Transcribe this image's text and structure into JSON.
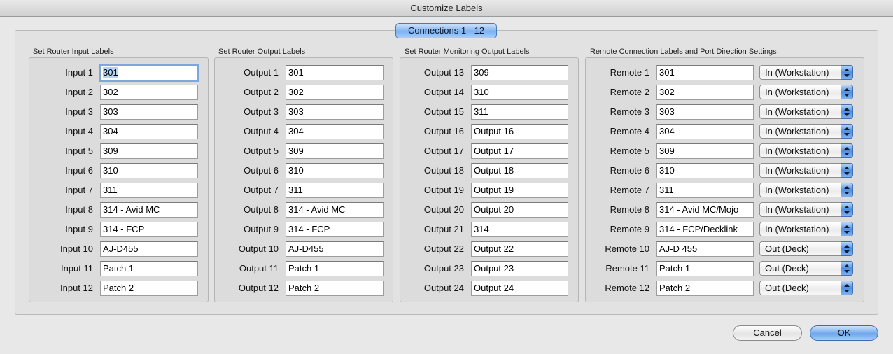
{
  "window": {
    "title": "Customize Labels"
  },
  "tab": {
    "label": "Connections 1 - 12"
  },
  "groups": {
    "inputs": {
      "title": "Set Router Input Labels",
      "labels": [
        "Input 1",
        "Input 2",
        "Input 3",
        "Input 4",
        "Input 5",
        "Input 6",
        "Input 7",
        "Input 8",
        "Input 9",
        "Input 10",
        "Input 11",
        "Input 12"
      ],
      "values": [
        "301",
        "302",
        "303",
        "304",
        "309",
        "310",
        "311",
        "314 - Avid MC",
        "314 - FCP",
        "AJ-D455",
        "Patch 1",
        "Patch 2"
      ]
    },
    "outputs": {
      "title": "Set Router Output Labels",
      "labels": [
        "Output 1",
        "Output 2",
        "Output 3",
        "Output 4",
        "Output 5",
        "Output 6",
        "Output 7",
        "Output 8",
        "Output 9",
        "Output 10",
        "Output 11",
        "Output 12"
      ],
      "values": [
        "301",
        "302",
        "303",
        "304",
        "309",
        "310",
        "311",
        "314 - Avid MC",
        "314 - FCP",
        "AJ-D455",
        "Patch 1",
        "Patch 2"
      ]
    },
    "monitoring": {
      "title": "Set Router Monitoring Output Labels",
      "labels": [
        "Output 13",
        "Output 14",
        "Output 15",
        "Output 16",
        "Output 17",
        "Output 18",
        "Output 19",
        "Output 20",
        "Output 21",
        "Output 22",
        "Output 23",
        "Output 24"
      ],
      "values": [
        "309",
        "310",
        "311",
        "Output 16",
        "Output 17",
        "Output 18",
        "Output 19",
        "Output 20",
        "314",
        "Output 22",
        "Output 23",
        "Output 24"
      ]
    },
    "remote": {
      "title": "Remote Connection Labels and Port Direction Settings",
      "labels": [
        "Remote 1",
        "Remote 2",
        "Remote 3",
        "Remote 4",
        "Remote 5",
        "Remote 6",
        "Remote 7",
        "Remote 8",
        "Remote 9",
        "Remote 10",
        "Remote 11",
        "Remote 12"
      ],
      "values": [
        "301",
        "302",
        "303",
        "304",
        "309",
        "310",
        "311",
        "314 - Avid MC/Mojo",
        "314 - FCP/Decklink",
        "AJ-D 455",
        "Patch 1",
        "Patch 2"
      ],
      "directions": [
        "In (Workstation)",
        "In (Workstation)",
        "In (Workstation)",
        "In (Workstation)",
        "In (Workstation)",
        "In (Workstation)",
        "In (Workstation)",
        "In (Workstation)",
        "In (Workstation)",
        "Out (Deck)",
        "Out (Deck)",
        "Out (Deck)"
      ]
    }
  },
  "buttons": {
    "cancel": "Cancel",
    "ok": "OK"
  },
  "colors": {
    "accent": "#7fb2ef",
    "focus_ring": "#7da7dc"
  },
  "icons": {
    "popup_arrows": "up-down-arrows-icon"
  }
}
